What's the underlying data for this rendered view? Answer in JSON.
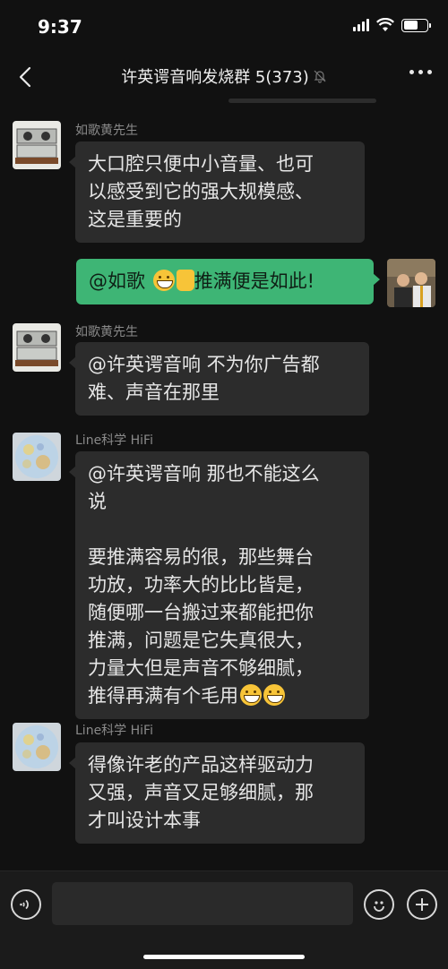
{
  "status": {
    "time": "9:37"
  },
  "header": {
    "title": "许英谔音响发烧群 5(373)"
  },
  "messages": [
    {
      "sender": "如歌黄先生",
      "text": "大口腔只便中小音量、也可\n以感受到它的强大规模感、\n这是重要的"
    },
    {
      "sender": "",
      "text": "@如歌 ",
      "text2": "推满便是如此!"
    },
    {
      "sender": "如歌黄先生",
      "text": "@许英谔音响 不为你广告都\n难、声音在那里"
    },
    {
      "sender": "Line科学 HiFi",
      "text": "@许英谔音响 那也不能这么\n说\n\n要推满容易的很，那些舞台\n功放，功率大的比比皆是，\n随便哪一台搬过来都能把你\n推满，问题是它失真很大，\n力量大但是声音不够细腻，\n推得再满有个毛用"
    },
    {
      "sender": "Line科学 HiFi",
      "text": "得像许老的产品这样驱动力\n又强，声音又足够细腻，那\n才叫设计本事"
    }
  ],
  "icons": {
    "back": "chevron-left-icon",
    "mute": "bell-slash-icon",
    "more": "more-dots-icon",
    "voice": "voice-icon",
    "emoji": "emoji-icon",
    "plus": "plus-icon"
  },
  "colors": {
    "background": "#111111",
    "bubble_other": "#2c2c2c",
    "bubble_self": "#3eb575"
  },
  "battery_level": 0.6
}
